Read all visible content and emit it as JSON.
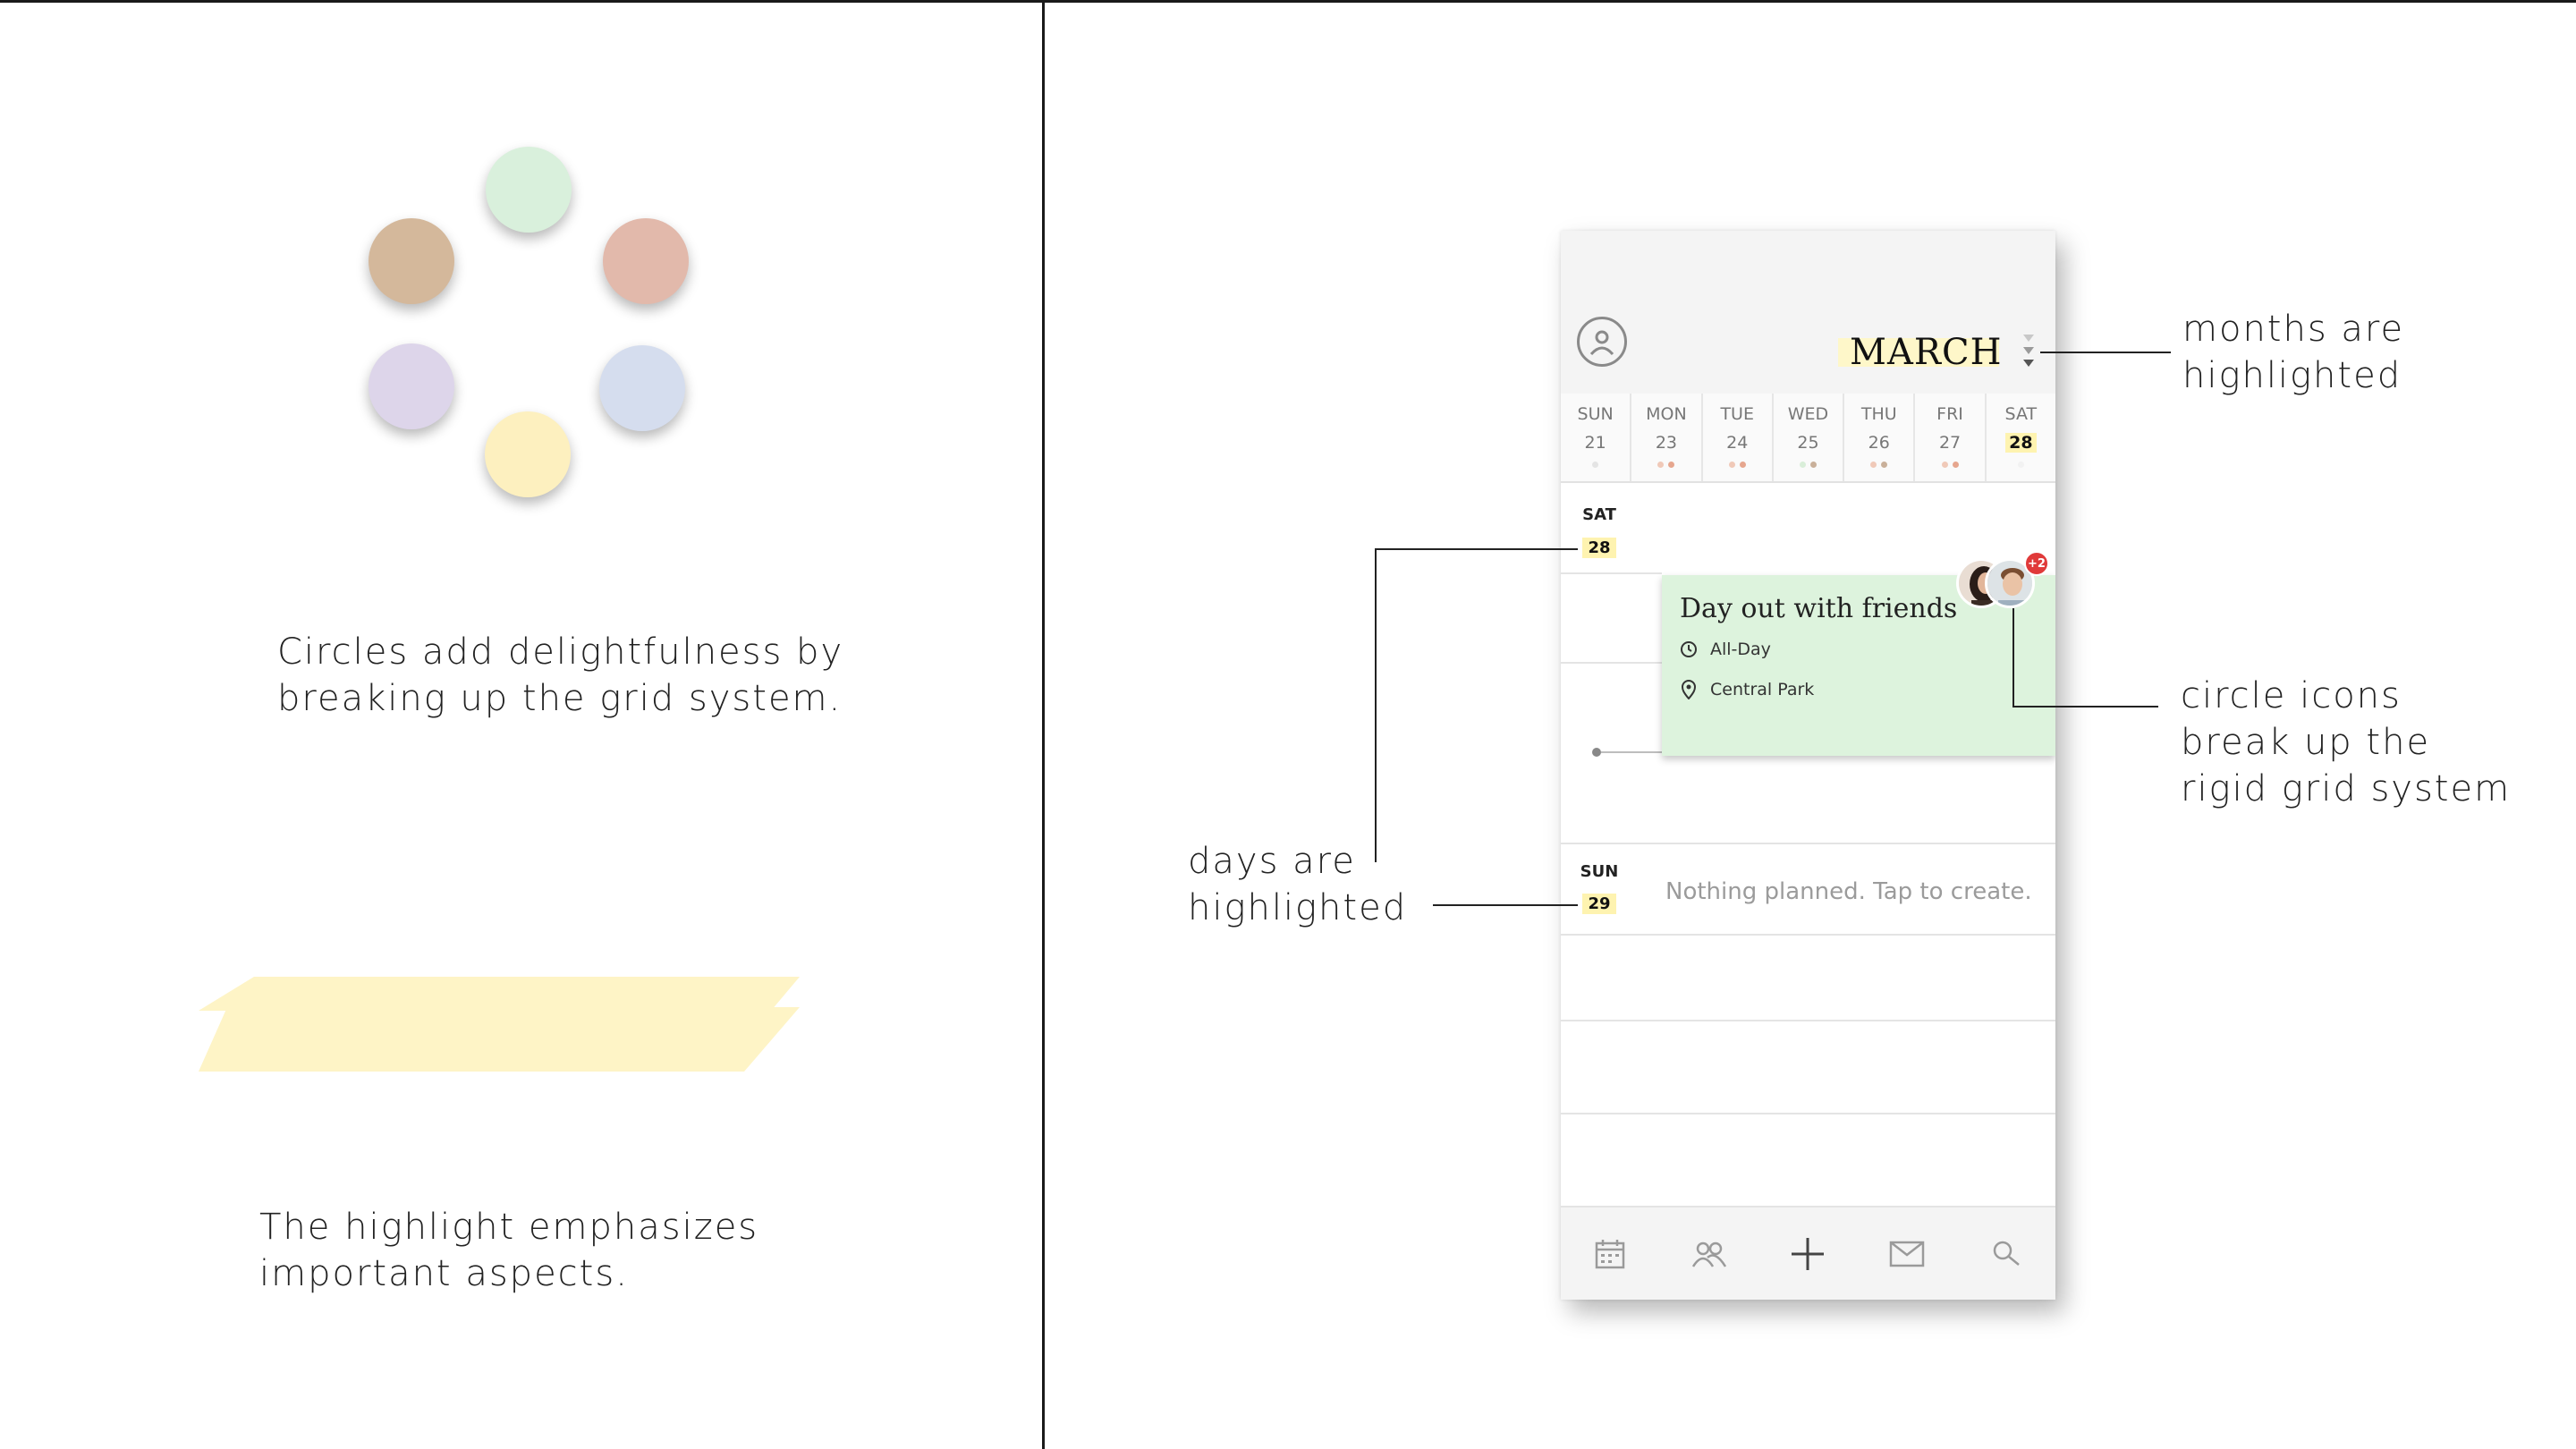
{
  "left_panel": {
    "circles_caption_line1": "Circles add delightfulness by",
    "circles_caption_line2": "breaking up the grid system.",
    "highlight_caption_line1": "The highlight emphasizes",
    "highlight_caption_line2": "important aspects.",
    "circle_colors": [
      "#d9f0dc",
      "#e2b9ab",
      "#d5ddee",
      "#fdf0bf",
      "#ddd5ea",
      "#d4b89b"
    ],
    "highlight_color": "#fef6cc"
  },
  "phone": {
    "month": "MARCH",
    "week": [
      {
        "name": "SUN",
        "num": "21"
      },
      {
        "name": "MON",
        "num": "23"
      },
      {
        "name": "TUE",
        "num": "24"
      },
      {
        "name": "WED",
        "num": "25"
      },
      {
        "name": "THU",
        "num": "26"
      },
      {
        "name": "FRI",
        "num": "27"
      },
      {
        "name": "SAT",
        "num": "28"
      }
    ],
    "day1": {
      "label": "SAT",
      "num": "28"
    },
    "day2": {
      "label": "SUN",
      "num": "29"
    },
    "event": {
      "title": "Day out with friends",
      "time": "All-Day",
      "location": "Central Park",
      "extra_attendees": "+2",
      "color": "#ddf3dd"
    },
    "empty_day_text": "Nothing planned. Tap to create.",
    "tabs": [
      "calendar-icon",
      "people-icon",
      "plus-icon",
      "mail-icon",
      "search-icon"
    ]
  },
  "annotations": {
    "months_line1": "months are",
    "months_line2": "highlighted",
    "circles_line1": "circle icons",
    "circles_line2": "break up the",
    "circles_line3": "rigid grid system",
    "days_line1": "days are",
    "days_line2": "highlighted"
  }
}
